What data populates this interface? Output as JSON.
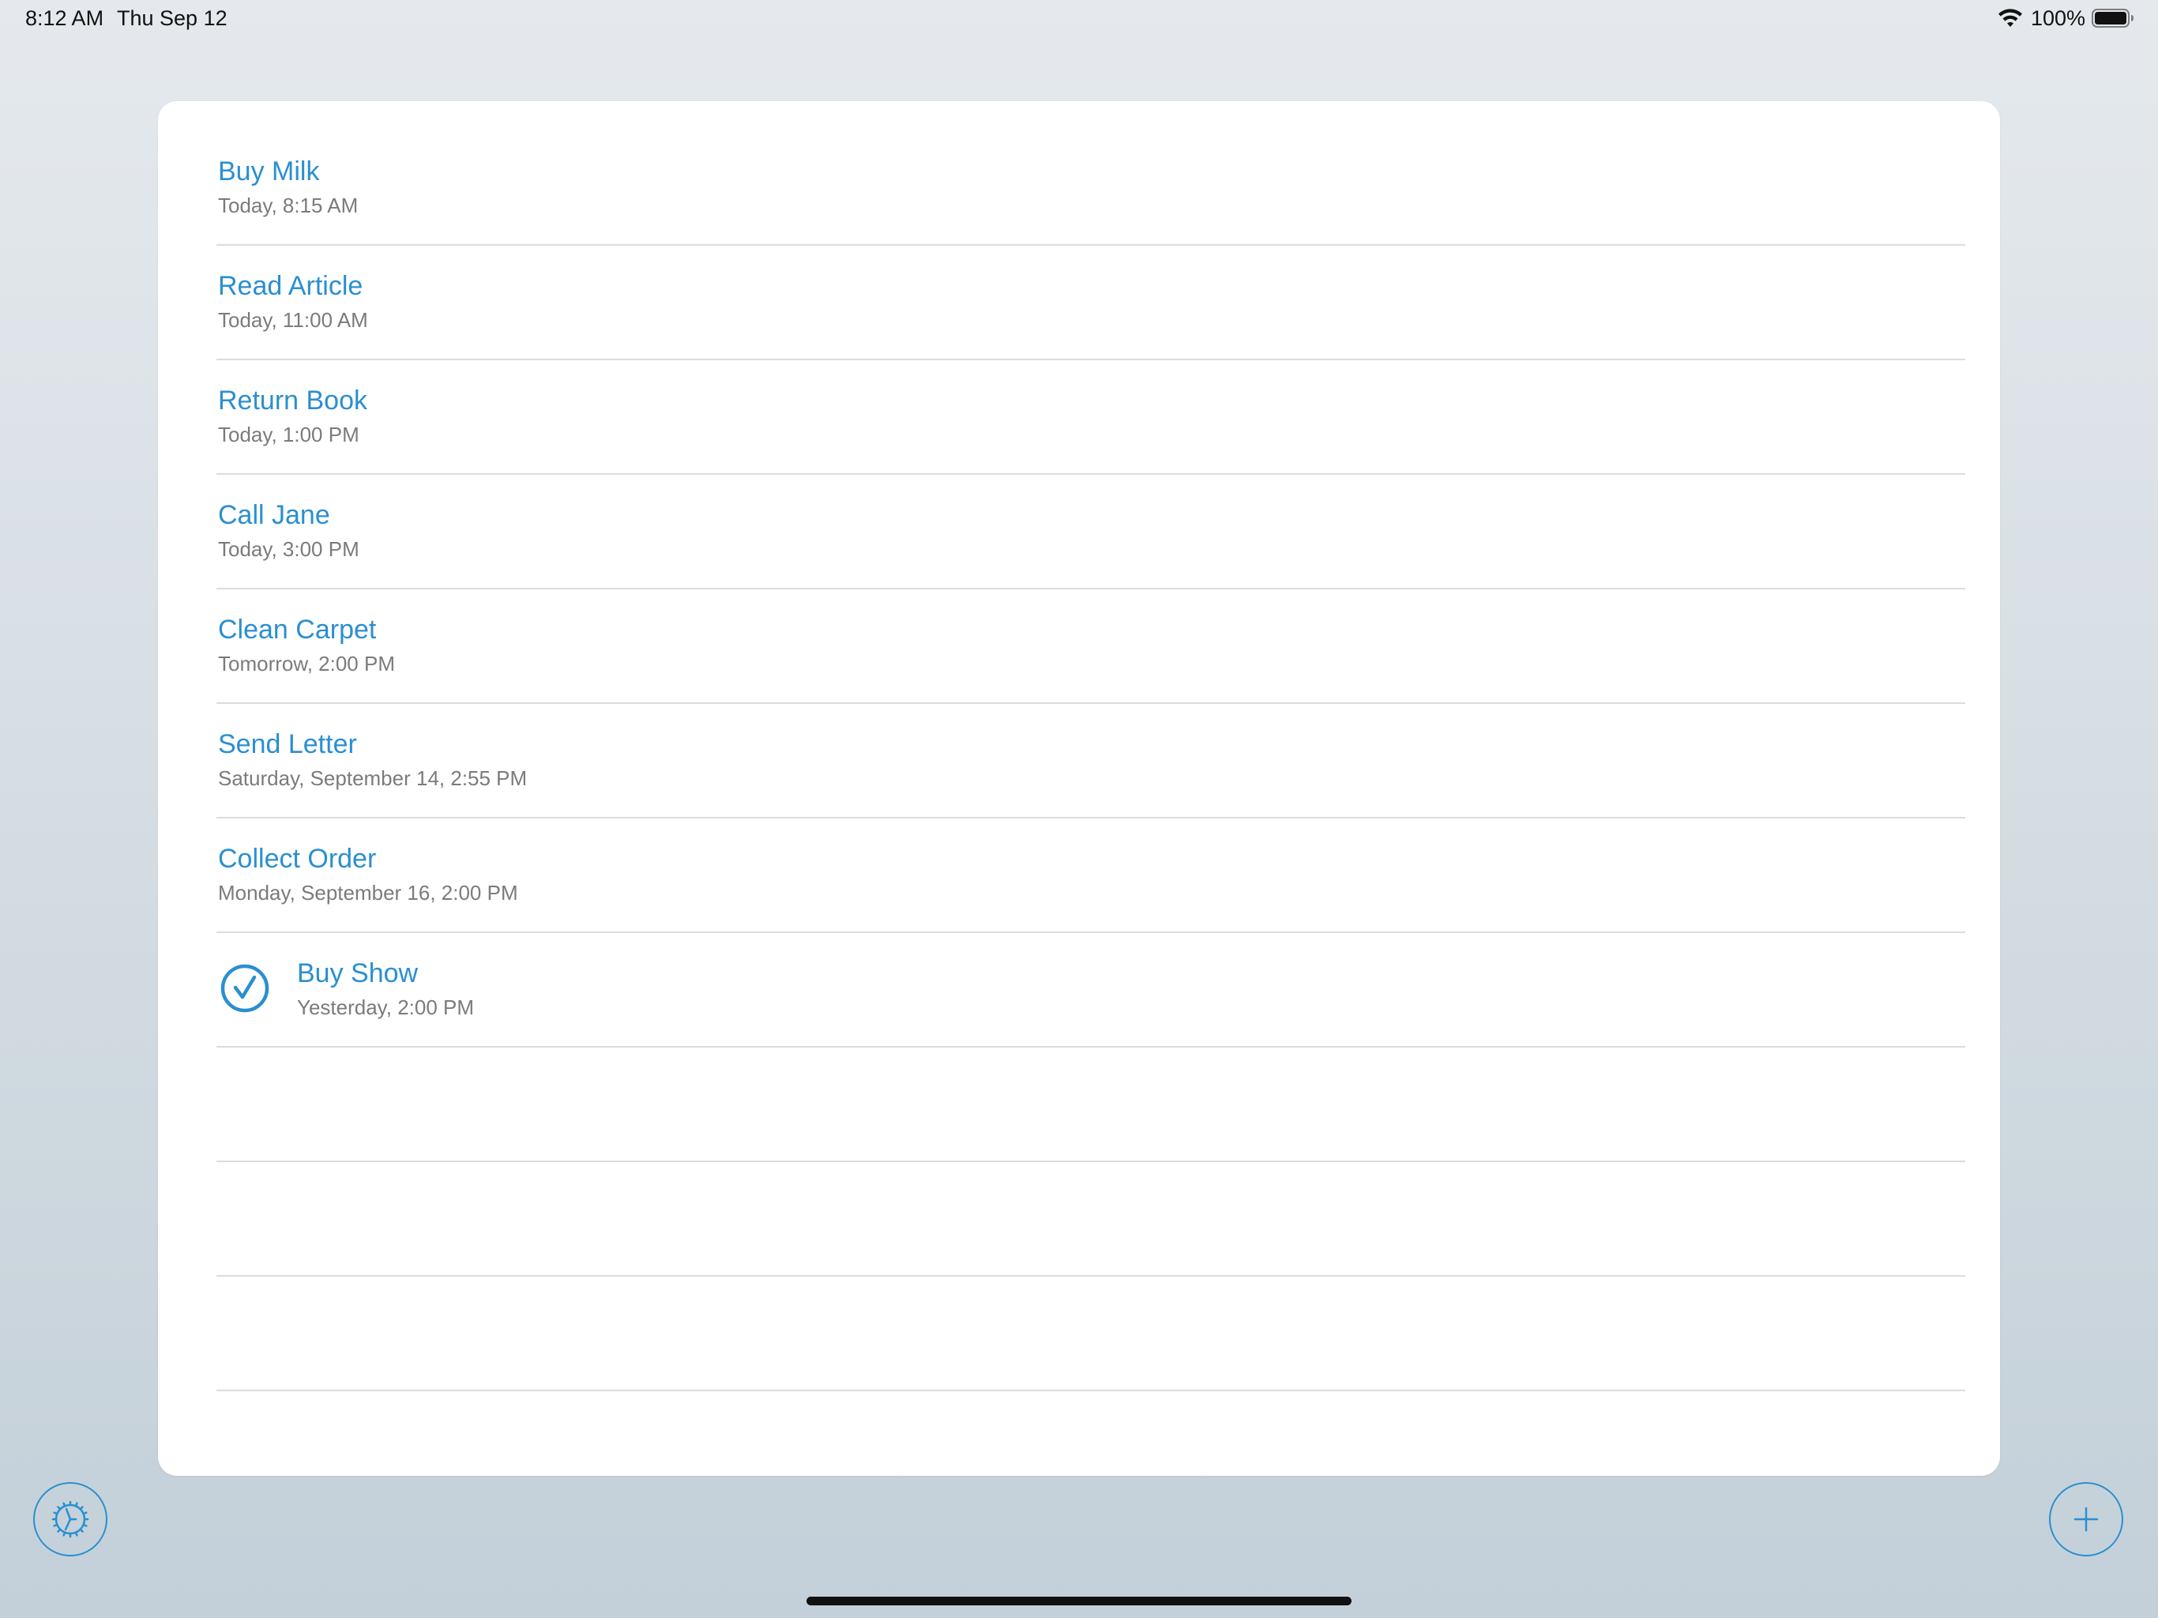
{
  "status_bar": {
    "time": "8:12 AM",
    "date": "Thu Sep 12",
    "battery_percent": "100%",
    "icons": [
      "wifi-icon",
      "battery-icon"
    ]
  },
  "reminders": [
    {
      "title": "Buy Milk",
      "due": "Today, 8:15 AM",
      "completed": false
    },
    {
      "title": "Read Article",
      "due": "Today, 11:00 AM",
      "completed": false
    },
    {
      "title": "Return Book",
      "due": "Today, 1:00 PM",
      "completed": false
    },
    {
      "title": "Call Jane",
      "due": "Today, 3:00 PM",
      "completed": false
    },
    {
      "title": "Clean Carpet",
      "due": "Tomorrow, 2:00 PM",
      "completed": false
    },
    {
      "title": "Send Letter",
      "due": "Saturday, September 14, 2:55 PM",
      "completed": false
    },
    {
      "title": "Collect Order",
      "due": "Monday, September 16, 2:00 PM",
      "completed": false
    },
    {
      "title": "Buy Show",
      "due": "Yesterday, 2:00 PM",
      "completed": true
    }
  ],
  "empty_rows": 3,
  "toolbar": {
    "settings_icon": "gear-icon",
    "add_icon": "plus-icon"
  },
  "colors": {
    "accent": "#2a8fd0",
    "subtitle": "#7b7b7b",
    "separator": "#dcdcdc",
    "card_background": "#ffffff"
  }
}
